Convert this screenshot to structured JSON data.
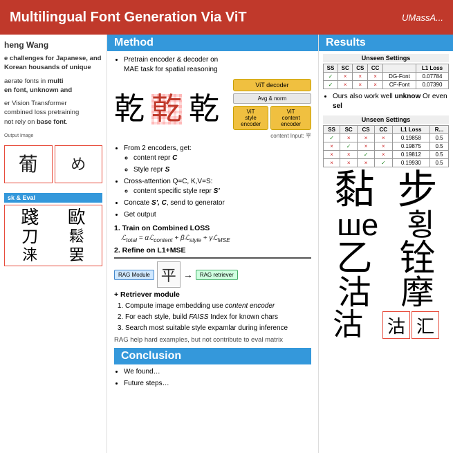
{
  "header": {
    "title": "Multilingual Font Generation Via ViT",
    "logo": "UMassA..."
  },
  "left": {
    "author": "heng Wang",
    "challenges_text": "e challenges for Japanese, and Korean housands of unique",
    "generate_text": "aerate fonts in multi en font, unknown and",
    "vit_text": "er Vision Transformer combined loss pretraining not rely on base font.",
    "section_task_eval": "sk & Eval"
  },
  "method": {
    "title": "Method",
    "bullets": [
      "Pretrain encoder & decoder on MAE task for spatial reasoning",
      "From 2 encoders, get:",
      "content repr C",
      "Style repr S",
      "Cross-attention Q=C, K,V=S:",
      "content specific style repr S'",
      "Concate S', C, send to generator",
      "Get output"
    ],
    "step1": "1. Train on Combined LOSS",
    "formula": "L_total = αL_content + βL_style + γL_MSE",
    "step2": "2. Refine on L1+MSE",
    "retriever_title": "+ Retriever module",
    "retriever_bullets": [
      "Compute image embedding use content encoder",
      "For each style, build FAISS Index for known chars",
      "Search most suitable style expamlar during inference"
    ],
    "rag_note": "RAG help hard examples, but not contribute to eval matrix"
  },
  "conclusion": {
    "title": "Conclusion",
    "bullets": [
      "We found…",
      "Future steps…"
    ]
  },
  "results": {
    "title": "Results",
    "table1_title": "Unseen Settings",
    "table1_headers": [
      "SS",
      "SC",
      "CS",
      "CC",
      "",
      "L1 Loss"
    ],
    "table1_rows": [
      [
        "✓",
        "×",
        "×",
        "×",
        "DG-Font",
        "0.07784"
      ],
      [
        "✓",
        "×",
        "×",
        "×",
        "CF-Font",
        "0.07390"
      ]
    ],
    "note": "Ours also work well unknow Or even sel",
    "table2_title": "Unseen Settings",
    "table2_headers": [
      "SS",
      "SC",
      "CS",
      "CC",
      "L1 Loss",
      "R..."
    ],
    "table2_rows": [
      [
        "✓",
        "×",
        "×",
        "×",
        "0.19858",
        "0.5"
      ],
      [
        "×",
        "✓",
        "×",
        "×",
        "0.19875",
        "0.5"
      ],
      [
        "×",
        "×",
        "✓",
        "×",
        "0.19812",
        "0.5"
      ],
      [
        "×",
        "×",
        "×",
        "✓",
        "0.19930",
        "0.5"
      ]
    ],
    "chars": {
      "row1": [
        "黏",
        "步"
      ],
      "row2": [
        "ше",
        "횡"
      ],
      "row3": [
        "乙",
        "铨"
      ],
      "row4": [
        "沽",
        "摩"
      ],
      "row5": [
        "沽",
        "汇"
      ]
    }
  }
}
